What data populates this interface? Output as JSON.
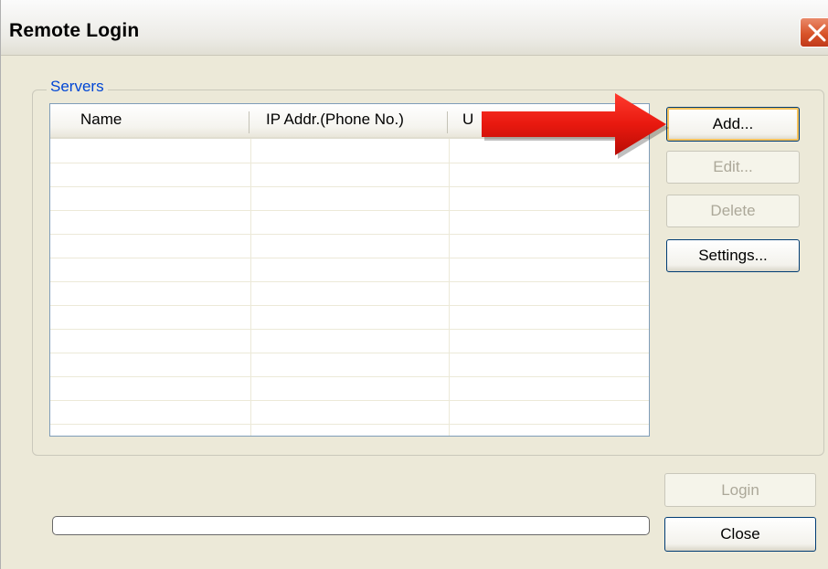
{
  "window": {
    "title": "Remote Login"
  },
  "servers_group": {
    "label": "Servers"
  },
  "table": {
    "columns": [
      "Name",
      "IP Addr.(Phone No.)",
      "U"
    ],
    "rows": []
  },
  "buttons": {
    "add": "Add...",
    "edit": "Edit...",
    "delete": "Delete",
    "settings": "Settings...",
    "login": "Login",
    "close": "Close"
  },
  "progress": {
    "value": 0
  },
  "colors": {
    "arrow": "#e8190f",
    "accent": "#0046d5"
  },
  "icons": {
    "close": "close-icon",
    "annotation": "red-arrow-icon"
  }
}
